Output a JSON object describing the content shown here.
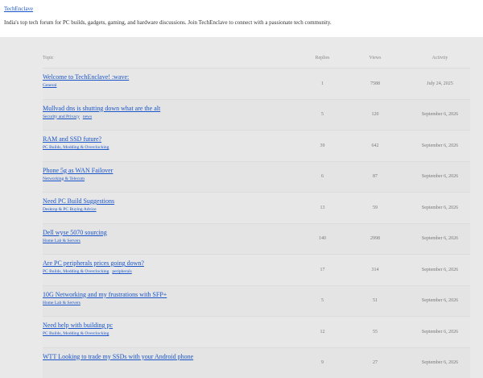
{
  "site": {
    "name": "TechEnclave",
    "tagline": "India's top tech forum for PC builds, gadgets, gaming, and hardware discussions. Join TechEnclave to connect with a passionate tech community."
  },
  "table": {
    "headers": {
      "topic": "Topic",
      "replies": "Replies",
      "views": "Views",
      "activity": "Activity"
    },
    "rows": [
      {
        "title": "Welcome to TechEnclave! :wave:",
        "tags": [
          "General"
        ],
        "replies": "1",
        "views": "7588",
        "activity": "July 24, 2025"
      },
      {
        "title": "Mullvad dns is shutting down what are the alt",
        "tags": [
          "Security and Privacy",
          "news"
        ],
        "replies": "5",
        "views": "120",
        "activity": "September 6, 2026"
      },
      {
        "title": "RAM and SSD future?",
        "tags": [
          "PC Builds, Modding & Overclocking"
        ],
        "replies": "39",
        "views": "642",
        "activity": "September 6, 2026"
      },
      {
        "title": "Phone 5g as WAN Failover",
        "tags": [
          "Networking & Telecom"
        ],
        "replies": "6",
        "views": "87",
        "activity": "September 6, 2026"
      },
      {
        "title": "Need PC Build Suggestions",
        "tags": [
          "Desktop & PC Buying Advice"
        ],
        "replies": "13",
        "views": "59",
        "activity": "September 6, 2026"
      },
      {
        "title": "Dell wyse 5070 sourcing",
        "tags": [
          "Home Lab & Servers"
        ],
        "replies": "140",
        "views": "2998",
        "activity": "September 6, 2026"
      },
      {
        "title": "Are PC peripherals prices going down?",
        "tags": [
          "PC Builds, Modding & Overclocking",
          "peripherals"
        ],
        "replies": "17",
        "views": "314",
        "activity": "September 6, 2026"
      },
      {
        "title": "10G Networking and my frustrations with SFP+",
        "tags": [
          "Home Lab & Servers"
        ],
        "replies": "5",
        "views": "51",
        "activity": "September 6, 2026"
      },
      {
        "title": "Need help with building pc",
        "tags": [
          "PC Builds, Modding & Overclocking"
        ],
        "replies": "12",
        "views": "55",
        "activity": "September 6, 2026"
      },
      {
        "title": "WTT Looking to trade my SSDs with your Android phone",
        "tags": [],
        "replies": "9",
        "views": "27",
        "activity": "September 6, 2026"
      }
    ]
  }
}
